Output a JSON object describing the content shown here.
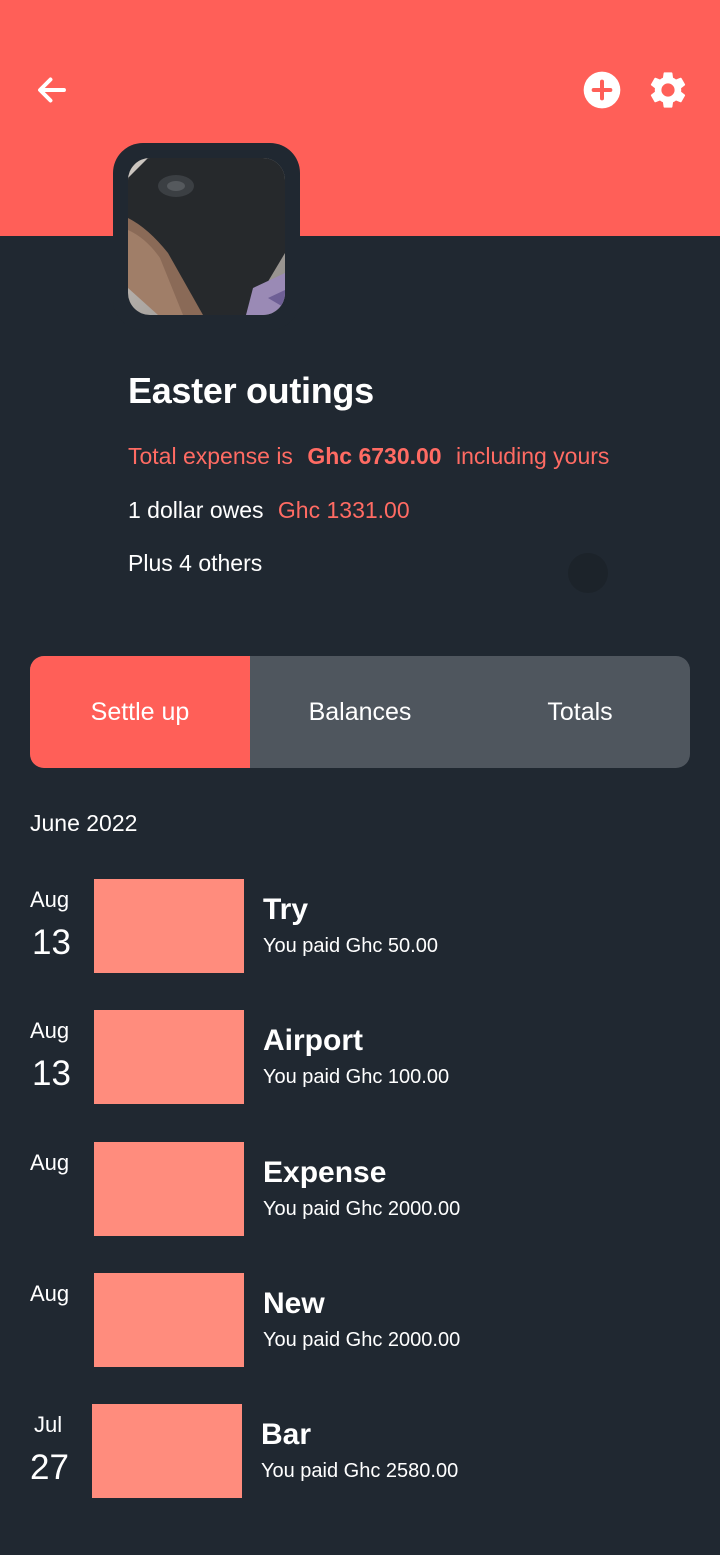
{
  "colors": {
    "accent": "#ff5f58",
    "background": "#202831",
    "tab_inactive": "#4f565e",
    "thumb": "#ff8c7d"
  },
  "header": {
    "back_icon": "arrow-left-icon",
    "add_icon": "plus-circle-icon",
    "settings_icon": "gear-icon"
  },
  "group": {
    "title": "Easter outings",
    "total_prefix": "Total expense is",
    "total_amount": "Ghc 6730.00",
    "total_suffix": "including yours",
    "owes_text": "1 dollar owes",
    "owes_amount": "Ghc 1331.00",
    "others_text": "Plus 4 others"
  },
  "tabs": [
    {
      "label": "Settle up",
      "active": true
    },
    {
      "label": "Balances",
      "active": false
    },
    {
      "label": "Totals",
      "active": false
    }
  ],
  "section": {
    "month": "June 2022"
  },
  "expenses": [
    {
      "month": "Aug",
      "day": "13",
      "title": "Try",
      "paid": "You paid Ghc 50.00"
    },
    {
      "month": "Aug",
      "day": "13",
      "title": "Airport",
      "paid": "You paid Ghc 100.00"
    },
    {
      "month": "Aug",
      "day": "",
      "title": "Expense",
      "paid": "You paid Ghc 2000.00"
    },
    {
      "month": "Aug",
      "day": "",
      "title": "New",
      "paid": "You paid Ghc 2000.00"
    },
    {
      "month": "Jul",
      "day": "27",
      "title": "Bar",
      "paid": "You paid Ghc 2580.00"
    }
  ]
}
